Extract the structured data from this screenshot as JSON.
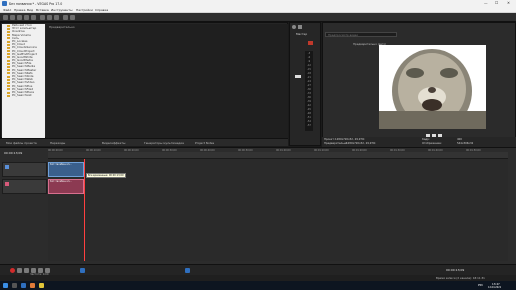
{
  "titlebar": {
    "title": "Без названия * - VEGAS Pro 17.0",
    "min": "—",
    "max": "☐",
    "close": "✕"
  },
  "menus": [
    "Файл",
    "Правка",
    "Вид",
    "Вставка",
    "Инструменты",
    "Настройки",
    "Справка"
  ],
  "explorer": {
    "tree": [
      "Рабочий стол",
      "Этот компьютер",
      "Onedrive",
      "Mapa Volume",
      "Сеть",
      "PC_Locales",
      "PC_Cloud",
      "PC_CloudsService",
      "PC_CloudProject",
      "PC_GetEndProject",
      "PC_GoodWhite",
      "PC_GoodMedia",
      "PC_SearchFile",
      "PC_SearchMedia",
      "PC_SearchMaster",
      "PC_SearchRefs",
      "PC_SearchSlide",
      "PC_SearchWeb",
      "PC_SearchVideo",
      "PC_SearchPlus",
      "PC_SearchFile2",
      "PC_SearchPlace",
      "PC_SearchList"
    ],
    "header": "Предварительно"
  },
  "tabs": [
    "Мои файлы проекта",
    "Переходы",
    "Видеоэффекты",
    "Генераторы мультимедиа",
    "Project Notes"
  ],
  "mixer": {
    "title": "Мастер",
    "meters": [
      "-3",
      "-6",
      "-9",
      "-12",
      "-15",
      "-18",
      "-21",
      "-24",
      "-27",
      "-30",
      "-33",
      "-36",
      "-39",
      "-42",
      "-45",
      "-48",
      "-51",
      "-54",
      "-57"
    ]
  },
  "preview": {
    "header": "Предварительно (авто)",
    "search_placeholder": "Предпросмотр видео"
  },
  "preview_info": {
    "label1": "Проект:",
    "val1": "1280x720x32, 29,970i",
    "label2": "Предварительно:",
    "val2": "1280x720x32, 29,970i",
    "label3": "Кадр:",
    "val3": "400",
    "label4": "Отображение:",
    "val4": "544x306x32"
  },
  "timeline": {
    "timecode": "00:00:13;09",
    "ruler": [
      "00:00:00;00",
      "00:00:10;00",
      "00:00:20;00",
      "00:00:30;00",
      "00:00:40;00",
      "00:00:50;00",
      "00:01:00;00",
      "00:01:10;00",
      "00:01:20;00",
      "00:01:30;00",
      "00:01:40;00",
      "00:01:50;00"
    ],
    "video_clip": "Кот-тасабин-хп...",
    "audio_clip": "Кот-тасабин-хп...",
    "tooltip": "Все временные: 00:00:13;09"
  },
  "transport": {
    "rate": "Частота: 0,00",
    "time": "00:00:13;09"
  },
  "status": {
    "text": "Время записи (2 канала): 18:11:31"
  },
  "taskbar": {
    "lang": "РУС",
    "clock": "13:47",
    "date": "12.04.2021"
  },
  "colors": {
    "accent": "#2f6fbf",
    "video_track": "#3a5f8c",
    "audio_track": "#8c3a52",
    "record": "#d12b2b"
  }
}
